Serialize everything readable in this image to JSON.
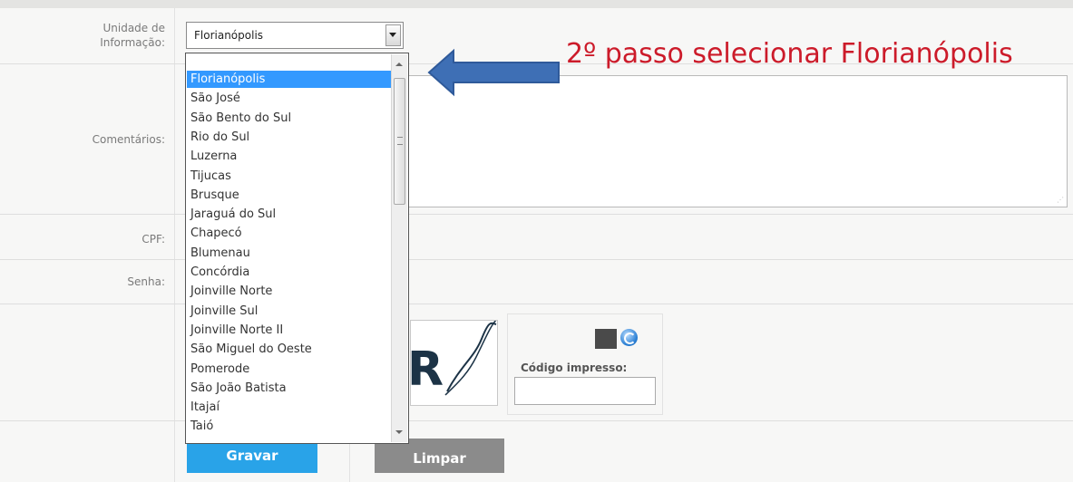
{
  "form": {
    "unidade_label": "Unidade de\nInformação:",
    "select_value": "Florianópolis",
    "comentarios_label": "Comentários:",
    "cpf_label": "CPF:",
    "senha_label": "Senha:",
    "dropdown_options": [
      "Florianópolis",
      "São José",
      "São Bento do Sul",
      "Rio do Sul",
      "Luzerna",
      "Tijucas",
      "Brusque",
      "Jaraguá do Sul",
      "Chapecó",
      "Blumenau",
      "Concórdia",
      "Joinville Norte",
      "Joinville Sul",
      "Joinville Norte II",
      "São Miguel do Oeste",
      "Pomerode",
      "São João Batista",
      "Itajaí",
      "Taió"
    ],
    "selected_index": 0
  },
  "captcha": {
    "image_text": "R",
    "codigo_label": "Código impresso:",
    "codigo_value": ""
  },
  "buttons": {
    "gravar": "Gravar",
    "limpar": "Limpar"
  },
  "annotation": {
    "text": "2º passo selecionar Florianópolis",
    "color": "#cc1b2a",
    "arrow_color": "#3e6fb5"
  },
  "colors": {
    "option_selected_bg": "#3399ff",
    "gravar_bg": "#29a3e8",
    "limpar_bg": "#8b8b8b"
  }
}
